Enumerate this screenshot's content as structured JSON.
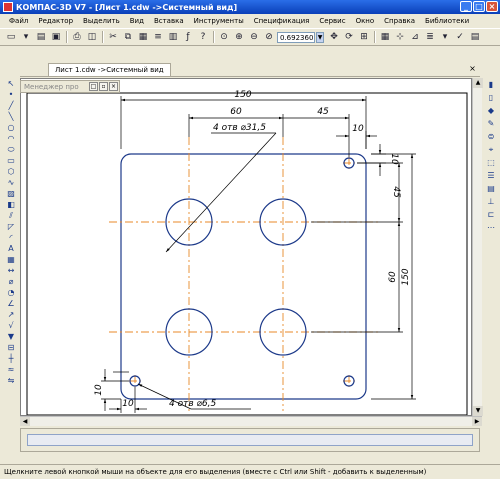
{
  "window": {
    "title": "КОМПАС-3D V7 - [Лист 1.cdw ->Системный вид]",
    "min": "_",
    "max": "□",
    "close": "×"
  },
  "menu": [
    {
      "label": "Файл"
    },
    {
      "label": "Редактор"
    },
    {
      "label": "Выделить"
    },
    {
      "label": "Вид"
    },
    {
      "label": "Вставка"
    },
    {
      "label": "Инструменты"
    },
    {
      "label": "Спецификация"
    },
    {
      "label": "Сервис"
    },
    {
      "label": "Окно"
    },
    {
      "label": "Справка"
    },
    {
      "label": "Библиотеки"
    }
  ],
  "toolbar": {
    "zoom_value": "0.692360"
  },
  "document_tab": {
    "label": "Лист 1.cdw ->Системный вид",
    "close": "×"
  },
  "panel": {
    "title": "Менеджер про",
    "btn1": "□",
    "btn2": "▫",
    "btn3": "×"
  },
  "drawing": {
    "dim_overall_width": "150",
    "dim_hole_spacing_h": "60",
    "dim_right_offset": "45",
    "dim_corner_x": "10",
    "dim_corner_y_right": "10",
    "dim_right_vert_offset": "45",
    "dim_hole_spacing_v": "60",
    "dim_overall_height": "150",
    "dim_bottom_y": "10",
    "dim_bottom_x": "10",
    "callout_large_holes": "4 отв ⌀31,5",
    "callout_small_holes": "4 отв ⌀6,5"
  },
  "status": {
    "text": "Щелкните левой кнопкой мыши на объекте для его выделения (вместе с Ctrl или Shift - добавить к выделенным)"
  }
}
